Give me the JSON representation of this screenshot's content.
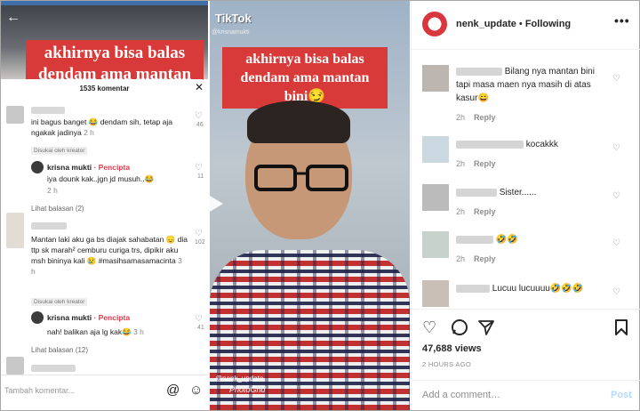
{
  "left_screenshot": {
    "caption": "akhirnya bisa balas dendam ama mantan",
    "comments_title": "1535 komentar",
    "close_icon": "close-icon",
    "comments": [
      {
        "text": "ini bagus banget 😂 dendam sih, tetap aja ngakak jadinya",
        "time": "2 h",
        "likes": "46"
      },
      {
        "badge": "Disukai oleh kreator",
        "user": "krisna mukti",
        "role": "· Pencipta",
        "text": "iya dounk kak..jgn jd musuh..😂",
        "time": "2 h",
        "likes": "11"
      },
      {
        "more": "Lihat balasan (2)"
      },
      {
        "text": "Mantan laki aku ga bs diajak sahabatan 😞 dia ttp sk marah² cemburu curiga trs, dipikir aku msh bininya kali 😢 #masihsamasamacinta",
        "time": "3 h",
        "likes": "102"
      },
      {
        "badge": "Disukai oleh kreator",
        "user": "krisna mukti",
        "role": "· Pencipta",
        "text": "nah! balikan aja lg kak😂",
        "time": "3 h",
        "likes": "41"
      },
      {
        "more": "Lihat balasan (12)"
      }
    ],
    "input_placeholder": "Tambah komentar..."
  },
  "right_screenshot": {
    "brand": "TikTok",
    "handle": "@krisnamukti",
    "caption": "akhirnya bisa balas dendam ama mantan bini😏",
    "watermark": "@nenk_update",
    "photogrid": "PhotoGrid"
  },
  "post": {
    "username": "nenk_update",
    "separator": " • ",
    "follow_label": "Following",
    "more_icon": "more-icon",
    "comments": [
      {
        "text": "Bilang nya mantan bini tapi masa maen nya masih di atas kasur😄",
        "time": "2h",
        "reply": "Reply"
      },
      {
        "text": "kocakkk",
        "time": "2h",
        "reply": "Reply"
      },
      {
        "text": "Sister......",
        "time": "2h",
        "reply": "Reply"
      },
      {
        "text": "🤣🤣",
        "time": "2h",
        "reply": "Reply"
      },
      {
        "text": "Lucuu lucuuuu🤣🤣🤣",
        "time": "2h",
        "reply": "Reply"
      }
    ],
    "views": "47,688 views",
    "posted_ago": "2 HOURS AGO",
    "add_comment_placeholder": "Add a comment…",
    "post_label": "Post"
  }
}
